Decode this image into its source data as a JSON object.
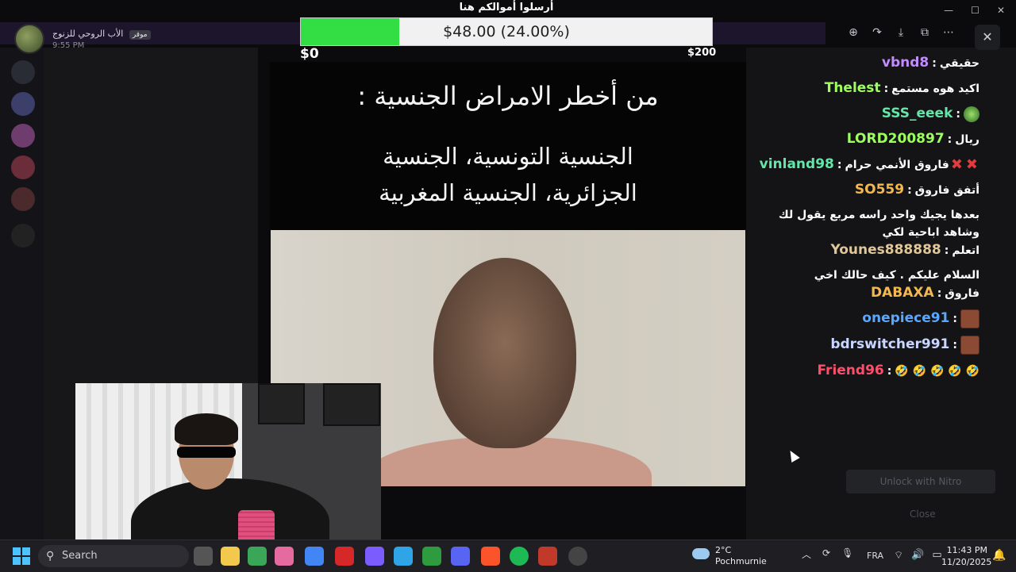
{
  "stream_header": {
    "user_name": "الأب الروحي للزنوج",
    "badge": "موقر",
    "time": "9:55 PM"
  },
  "donation_goal": {
    "title": "أرسلوا أموالكم هنا",
    "current_text": "$48.00 (24.00%)",
    "progress_fraction": 0.24,
    "min_label": "$0",
    "max_label": "$200",
    "color": "#33dd44"
  },
  "slide": {
    "title": "من أخطر الامراض الجنسية :",
    "line1": "الجنسية التونسية، الجنسية",
    "line2": "الجزائرية، الجنسية المغربية"
  },
  "chat": {
    "messages": [
      {
        "user": "vbnd8",
        "color": "#c28bff",
        "text": "حقيقي"
      },
      {
        "user": "Thelest",
        "color": "#9cff5c",
        "text": "اكيد هوه مستمع"
      },
      {
        "user": "SSS_eeek",
        "color": "#64e6a8",
        "text": ""
      },
      {
        "user": "LORD200897",
        "color": "#9cff5c",
        "text": "ريال"
      },
      {
        "user": "vinland98",
        "color": "#64e6a8",
        "text": "فاروق الأنمي حرام"
      },
      {
        "user": "SO559",
        "color": "#f4b84e",
        "text": "أتفق فاروق"
      },
      {
        "user": "Younes888888",
        "color": "#dfc79a",
        "text": "بعدها يجيك واحد راسه مربع يقول لك وشاهد اباحية لكي اتعلم"
      },
      {
        "user": "DABAXA",
        "color": "#f4b84e",
        "text": "السلام عليكم . كيف حالك اخي فاروق"
      },
      {
        "user": "onepiece91",
        "color": "#5aa7ff",
        "text": ""
      },
      {
        "user": "bdrswitcher991",
        "color": "#c9d6ff",
        "text": ""
      },
      {
        "user": "Friend96",
        "color": "#ff4d6a",
        "text": "🤣 🤣 🤣 🤣 🤣"
      }
    ],
    "separator": ":"
  },
  "overlay": {
    "nitro_label": "Unlock with Nitro",
    "close_label": "Close"
  },
  "taskbar": {
    "search_placeholder": "Search",
    "weather_temp": "2°C",
    "weather_place": "Pochmurnie",
    "language": "FRA",
    "time": "11:43 PM",
    "date": "11/20/2025"
  }
}
